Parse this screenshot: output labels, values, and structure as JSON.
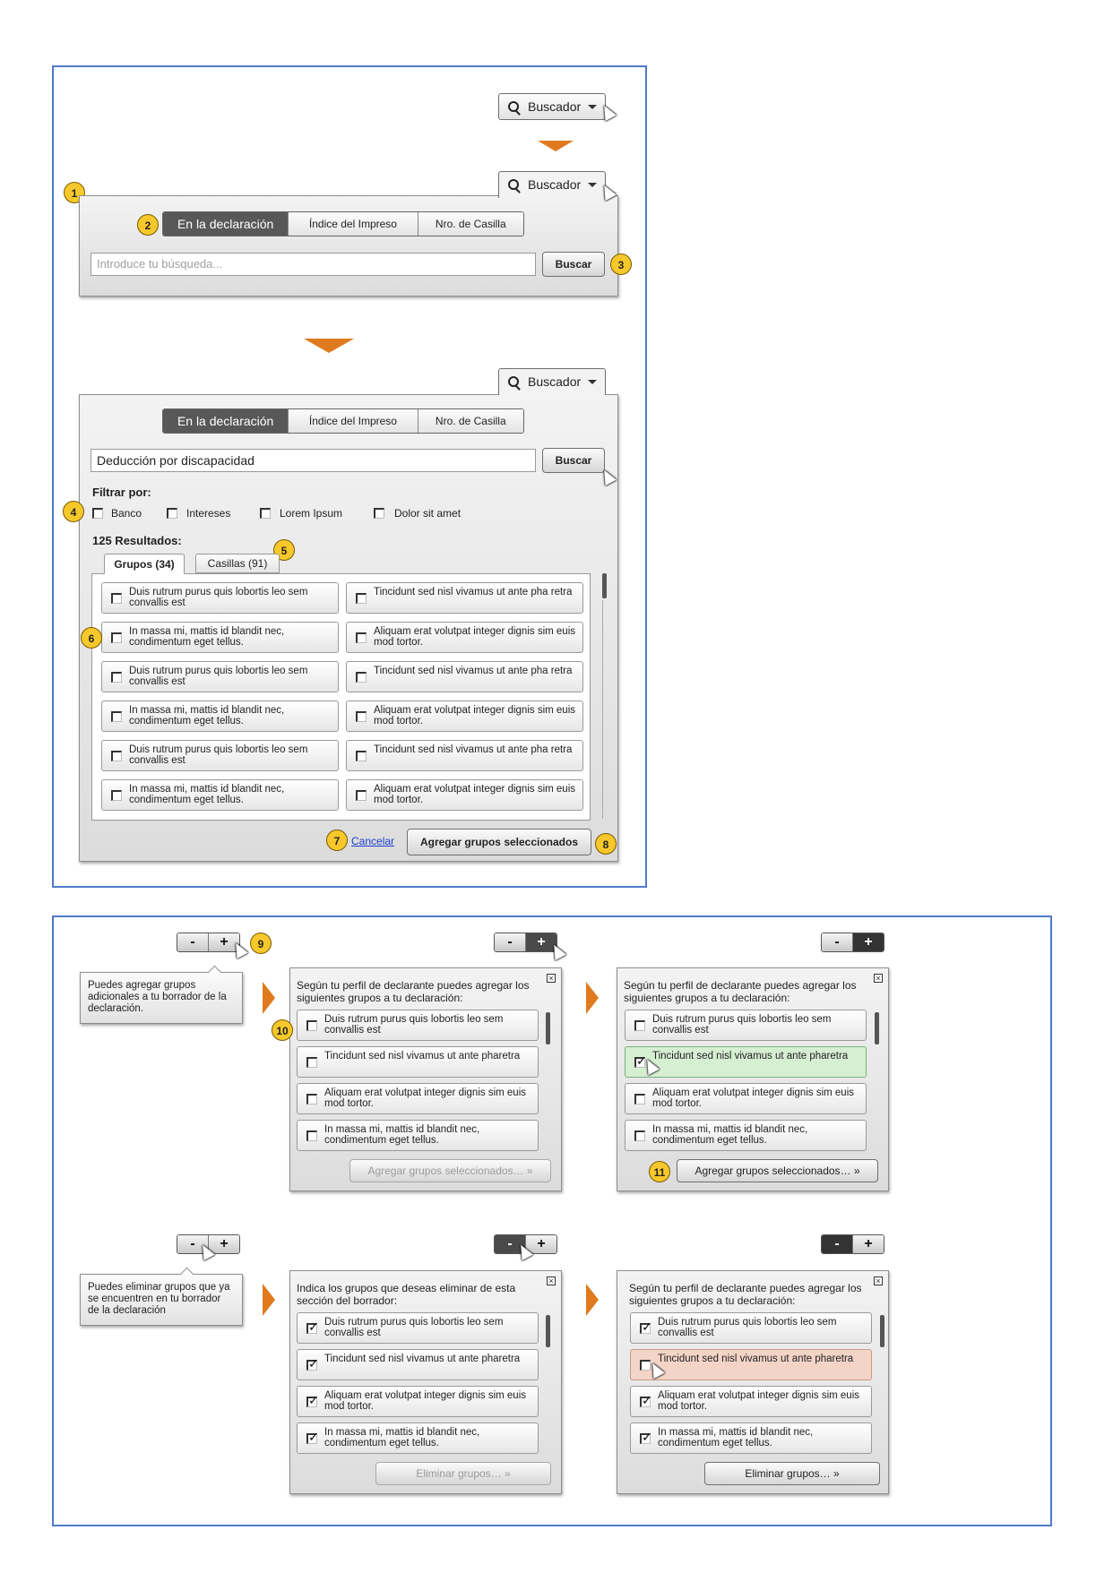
{
  "search_label": "Buscador",
  "tabs": [
    "En la declaración",
    "Índice del Impreso",
    "Nro. de Casilla"
  ],
  "input_placeholder": "Introduce tu búsqueda...",
  "input_value": "Deducción por discapacidad",
  "search_button": "Buscar",
  "filter_label": "Filtrar por:",
  "filters": [
    "Banco",
    "Intereses",
    "Lorem Ipsum",
    "Dolor sit amet"
  ],
  "results_count": "125 Resultados:",
  "result_tabs": [
    "Grupos (34)",
    "Casillas (91)"
  ],
  "result_items": [
    [
      "Duis rutrum purus quis lobortis leo sem convallis est",
      "Tincidunt sed nisl vivamus ut ante pha retra"
    ],
    [
      "In massa mi, mattis id blandit nec, condimentum eget tellus.",
      "Aliquam erat volutpat integer dignis sim euis mod tortor."
    ],
    [
      "Duis rutrum purus quis lobortis leo sem convallis est",
      "Tincidunt sed nisl vivamus ut ante pha retra"
    ],
    [
      "In massa mi, mattis id blandit nec, condimentum eget tellus.",
      "Aliquam erat volutpat integer dignis sim euis mod tortor."
    ],
    [
      "Duis rutrum purus quis lobortis leo sem convallis est",
      "Tincidunt sed nisl vivamus ut ante pha retra"
    ],
    [
      "In massa mi, mattis id blandit nec, condimentum eget tellus.",
      "Aliquam erat volutpat integer dignis sim euis mod tortor."
    ]
  ],
  "cancel_link": "Cancelar",
  "add_selected_bold": "Agregar grupos seleccionados",
  "badges": [
    "1",
    "2",
    "3",
    "4",
    "5",
    "6",
    "7",
    "8",
    "9",
    "10",
    "11"
  ],
  "minus": "-",
  "plus": "+",
  "tip_add": "Puedes agregar grupos adicionales a tu borrador de la declaración.",
  "tip_remove": "Puedes eliminar grupos que ya se encuentren en tu borrador de la declaración",
  "msg_add": "Según tu perfil de declarante puedes agregar los siguientes grupos a tu declaración:",
  "msg_remove": "Indica los grupos que deseas eliminar de esta sección del borrador:",
  "group_items": [
    "Duis rutrum purus quis lobortis leo sem convallis est",
    "Tincidunt sed nisl vivamus ut ante pharetra",
    "Aliquam erat volutpat integer dignis sim euis mod tortor.",
    "In massa mi, mattis id blandit nec, condimentum eget tellus."
  ],
  "add_groups_btn": "Agregar grupos seleccionados… »",
  "remove_groups_btn": "Eliminar grupos… »",
  "colors": {
    "accent_arrow": "#e07a1e",
    "frame_border": "#4f7ac7",
    "badge": "#f7c82b",
    "selected_green": "#d6efd2",
    "selected_red": "#f3d4c6"
  }
}
